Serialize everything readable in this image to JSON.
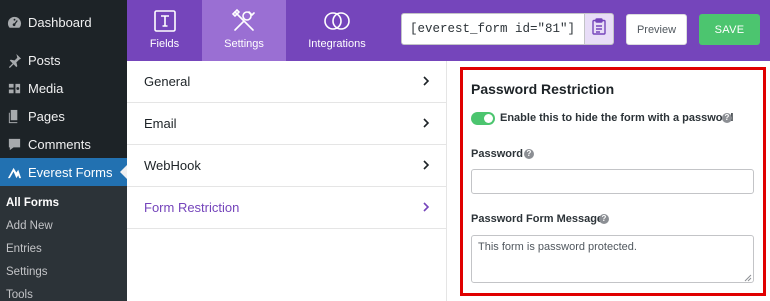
{
  "sidebar": {
    "items": [
      {
        "label": "Dashboard",
        "icon": "dashboard-icon"
      },
      {
        "label": "Posts",
        "icon": "pin-icon"
      },
      {
        "label": "Media",
        "icon": "media-icon"
      },
      {
        "label": "Pages",
        "icon": "pages-icon"
      },
      {
        "label": "Comments",
        "icon": "comment-icon"
      },
      {
        "label": "Everest Forms",
        "icon": "everest-forms-icon"
      }
    ],
    "submenu": [
      "All Forms",
      "Add New",
      "Entries",
      "Settings",
      "Tools"
    ]
  },
  "toolbar": {
    "tabs": [
      {
        "label": "Fields",
        "icon": "fields-icon"
      },
      {
        "label": "Settings",
        "icon": "settings-tools-icon"
      },
      {
        "label": "Integrations",
        "icon": "integrations-icon"
      }
    ],
    "shortcode": "[everest_form id=\"81\"]",
    "preview_label": "Preview",
    "save_label": "SAVE"
  },
  "settings_nav": {
    "items": [
      "General",
      "Email",
      "WebHook",
      "Form Restriction"
    ]
  },
  "panel": {
    "title": "Password Restriction",
    "toggle_label": "Enable this to hide the form with a password",
    "toggle_on": true,
    "password_label": "Password",
    "password_value": "",
    "message_label": "Password Form Message",
    "message_value": "This form is password protected."
  },
  "colors": {
    "builder_bar": "#7545bb",
    "active_tab": "#9a6fd3",
    "save_green": "#4cc56f",
    "highlight_red": "#e00000",
    "wp_active": "#2271b1"
  }
}
